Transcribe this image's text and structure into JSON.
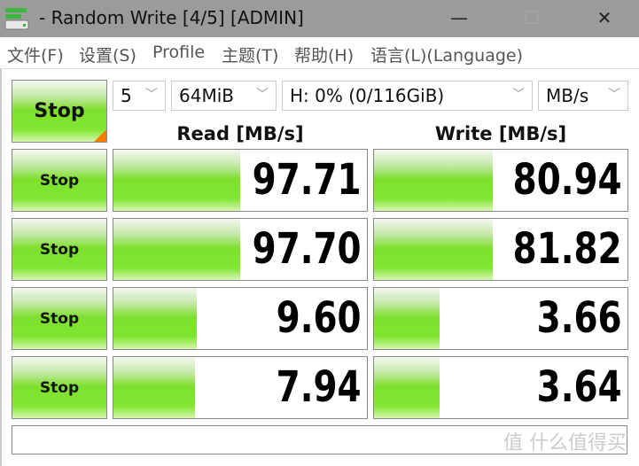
{
  "window": {
    "title": "- Random Write [4/5] [ADMIN]",
    "minimize": "—",
    "maximize": "☐",
    "close": "✕"
  },
  "menu": [
    "文件(F)",
    "设置(S)",
    "Profile",
    "主题(T)",
    "帮助(H)",
    "语言(L)(Language)"
  ],
  "controls": {
    "all_button": "Stop",
    "count": "5",
    "size": "64MiB",
    "drive": "H: 0% (0/116GiB)",
    "unit": "MB/s"
  },
  "headers": {
    "read": "Read [MB/s]",
    "write": "Write [MB/s]"
  },
  "rows": [
    {
      "button": "Stop",
      "read": "97.71",
      "write": "80.94",
      "read_fill": 0.5,
      "write_fill": 0.47
    },
    {
      "button": "Stop",
      "read": "97.70",
      "write": "81.82",
      "read_fill": 0.5,
      "write_fill": 0.47
    },
    {
      "button": "Stop",
      "read": "9.60",
      "write": "3.66",
      "read_fill": 0.33,
      "write_fill": 0.26
    },
    {
      "button": "Stop",
      "read": "7.94",
      "write": "3.64",
      "read_fill": 0.32,
      "write_fill": 0.26
    }
  ],
  "status": "",
  "watermark": "值 什么值得买",
  "colors": {
    "accent_green": "#7ee02e",
    "corner_orange": "#ff7a00"
  }
}
